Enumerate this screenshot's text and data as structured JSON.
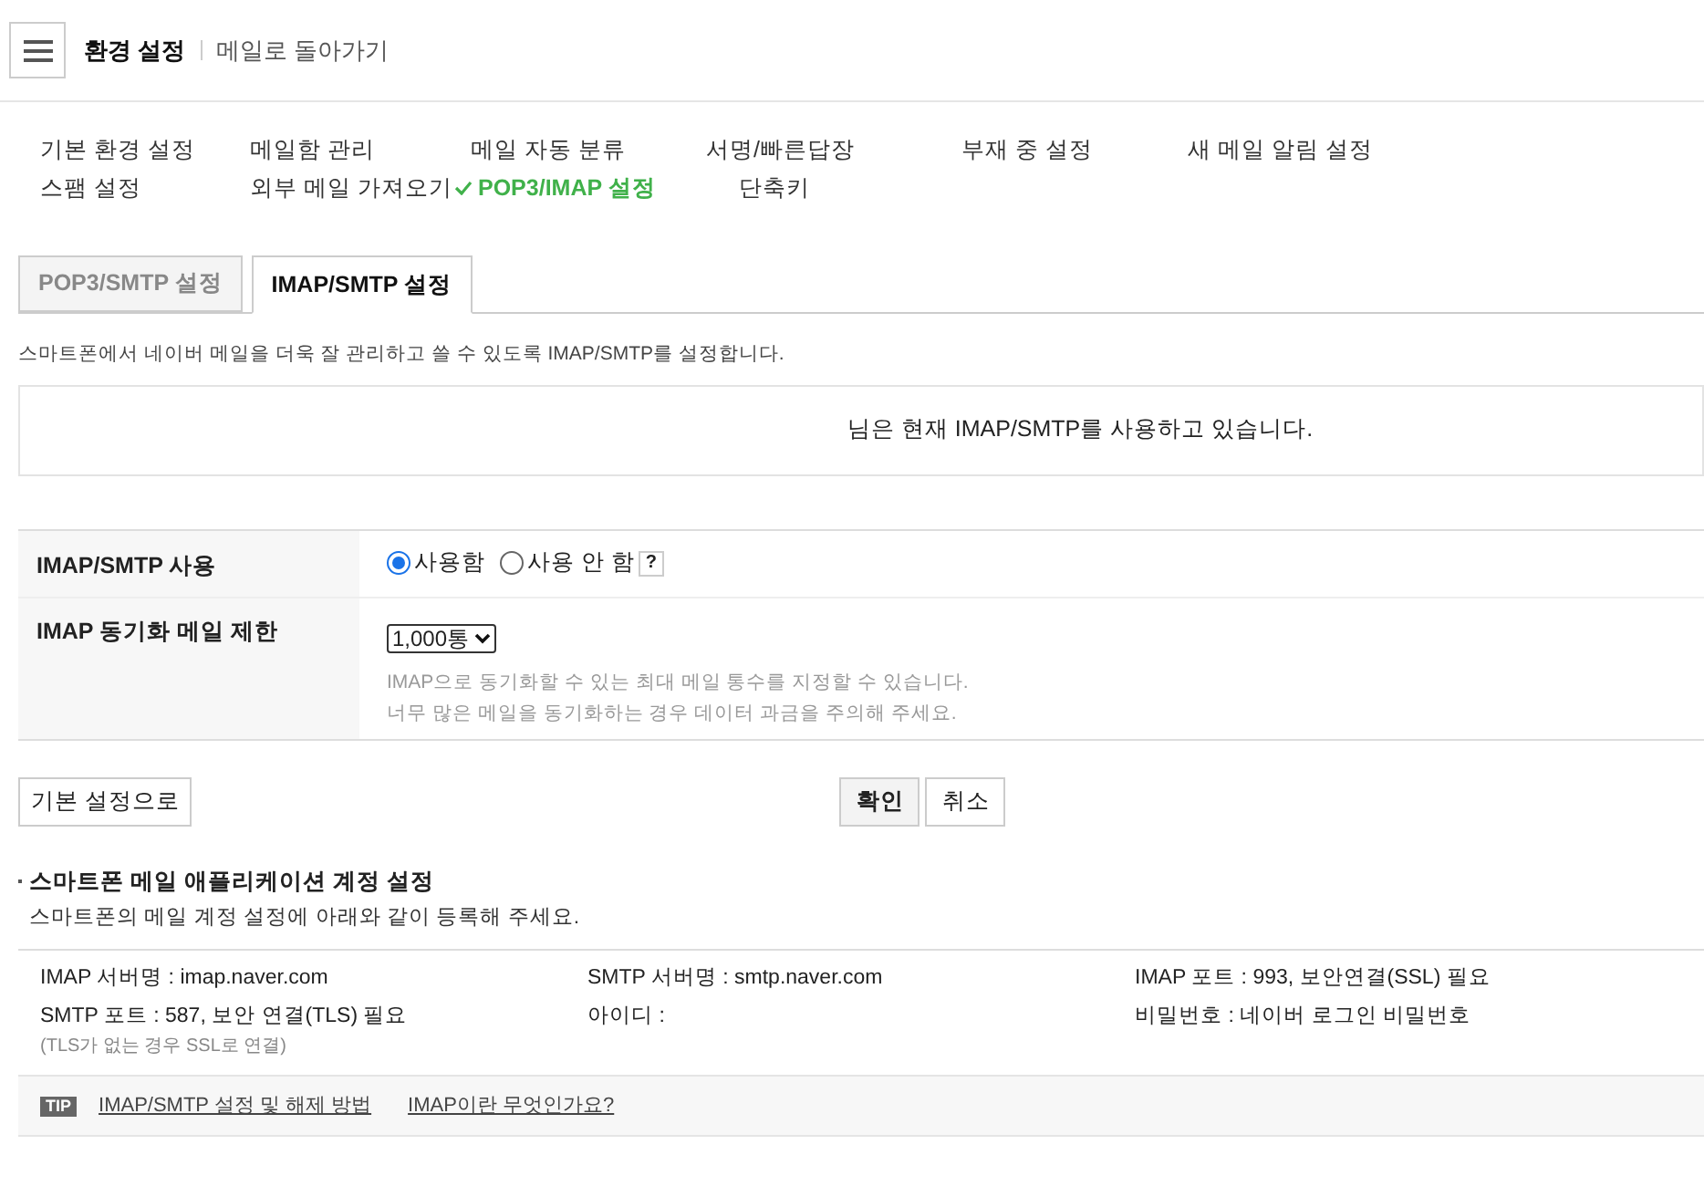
{
  "header": {
    "title": "환경 설정",
    "back_link": "메일로 돌아가기"
  },
  "settings_menu": [
    {
      "label": "기본 환경 설정",
      "selected": false
    },
    {
      "label": "메일함 관리",
      "selected": false
    },
    {
      "label": "메일 자동 분류",
      "selected": false
    },
    {
      "label": "서명/빠른답장",
      "selected": false
    },
    {
      "label": "부재 중 설정",
      "selected": false
    },
    {
      "label": "새 메일 알림 설정",
      "selected": false
    },
    {
      "label": "스팸 설정",
      "selected": false
    },
    {
      "label": "외부 메일 가져오기",
      "selected": false
    },
    {
      "label": "POP3/IMAP 설정",
      "selected": true
    },
    {
      "label": "단축키",
      "selected": false
    }
  ],
  "tabs": [
    {
      "label": "POP3/SMTP 설정",
      "selected": false
    },
    {
      "label": "IMAP/SMTP 설정",
      "selected": true
    }
  ],
  "description": "스마트폰에서 네이버 메일을 더욱 잘 관리하고 쓸 수 있도록 IMAP/SMTP를 설정합니다.",
  "status_message": "님은 현재 IMAP/SMTP를 사용하고 있습니다.",
  "form": {
    "imap_use": {
      "label": "IMAP/SMTP 사용",
      "options": [
        {
          "label": "사용함",
          "selected": true
        },
        {
          "label": "사용 안 함",
          "selected": false
        }
      ],
      "help": "?"
    },
    "sync_limit": {
      "label": "IMAP 동기화 메일 제한",
      "value": "1,000통",
      "hints": [
        "IMAP으로 동기화할 수 있는 최대 메일 통수를 지정할 수 있습니다.",
        "너무 많은 메일을 동기화하는 경우 데이터 과금을 주의해 주세요."
      ]
    }
  },
  "buttons": {
    "reset": "기본 설정으로",
    "confirm": "확인",
    "cancel": "취소"
  },
  "account_section": {
    "title": "스마트폰 메일 애플리케이션 계정 설정",
    "subtitle": "스마트폰의 메일 계정 설정에 아래와 같이 등록해 주세요.",
    "items": [
      {
        "text": "IMAP 서버명 : imap.naver.com"
      },
      {
        "text": "SMTP 서버명 : smtp.naver.com"
      },
      {
        "text": "IMAP 포트 : 993, 보안연결(SSL) 필요"
      },
      {
        "text": "SMTP 포트 : 587, 보안 연결(TLS) 필요",
        "note": "(TLS가 없는 경우 SSL로 연결)"
      },
      {
        "text": "아이디 :"
      },
      {
        "text": "비밀번호 : 네이버 로그인 비밀번호"
      }
    ]
  },
  "tip": {
    "badge": "TIP",
    "links": [
      "IMAP/SMTP 설정 및 해제 방법",
      "IMAP이란 무엇인가요?"
    ]
  }
}
